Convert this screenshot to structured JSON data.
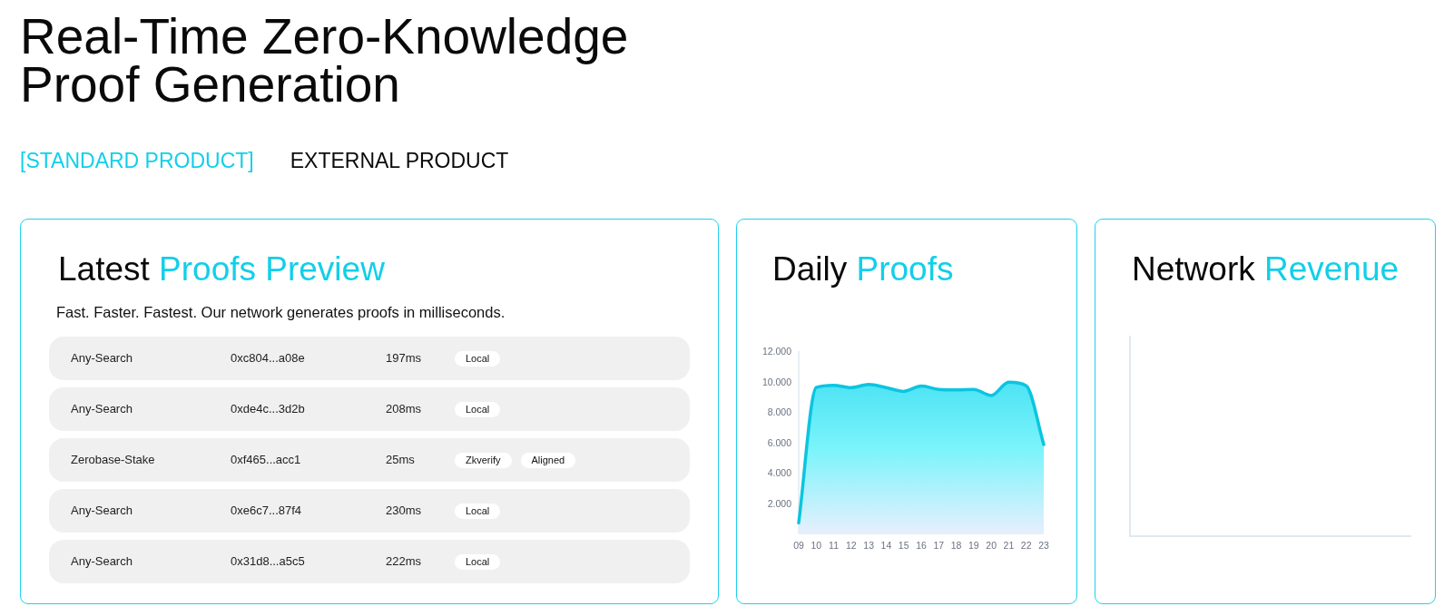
{
  "heading": {
    "title": "Real-Time Zero-Knowledge Proof Generation"
  },
  "tabs": [
    {
      "label": "[STANDARD PRODUCT]",
      "selected": true
    },
    {
      "label": "EXTERNAL PRODUCT",
      "selected": false
    }
  ],
  "proofs_card": {
    "title": {
      "lead": "Latest",
      "accent": "Proofs Preview"
    },
    "subtitle": "Fast. Faster. Fastest. Our network generates proofs in milliseconds.",
    "rows": [
      {
        "name": "Any-Search",
        "hash": "0xc804...a08e",
        "time": "197ms",
        "tags": [
          "Local"
        ]
      },
      {
        "name": "Any-Search",
        "hash": "0xde4c...3d2b",
        "time": "208ms",
        "tags": [
          "Local"
        ]
      },
      {
        "name": "Zerobase-Stake",
        "hash": "0xf465...acc1",
        "time": "25ms",
        "tags": [
          "Zkverify",
          "Aligned"
        ]
      },
      {
        "name": "Any-Search",
        "hash": "0xe6c7...87f4",
        "time": "230ms",
        "tags": [
          "Local"
        ]
      },
      {
        "name": "Any-Search",
        "hash": "0x31d8...a5c5",
        "time": "222ms",
        "tags": [
          "Local"
        ]
      }
    ]
  },
  "daily_card": {
    "title": {
      "lead": "Daily",
      "accent": "Proofs"
    },
    "chart_data": {
      "type": "area",
      "categories": [
        "09",
        "10",
        "11",
        "12",
        "13",
        "14",
        "15",
        "16",
        "17",
        "18",
        "19",
        "20",
        "21",
        "22",
        "23"
      ],
      "values": [
        700,
        9600,
        9750,
        9600,
        9800,
        9600,
        9350,
        9700,
        9480,
        9450,
        9480,
        9080,
        9950,
        9720,
        5850
      ],
      "ylim": [
        0,
        12000
      ],
      "yticks": [
        {
          "value": 2000,
          "label": "2.000"
        },
        {
          "value": 4000,
          "label": "4.000"
        },
        {
          "value": 6000,
          "label": "6.000"
        },
        {
          "value": 8000,
          "label": "8.000"
        },
        {
          "value": 10000,
          "label": "10.000"
        },
        {
          "value": 12000,
          "label": "12.000"
        }
      ]
    }
  },
  "revenue_card": {
    "title": {
      "lead": "Network",
      "accent": "Revenue"
    }
  }
}
